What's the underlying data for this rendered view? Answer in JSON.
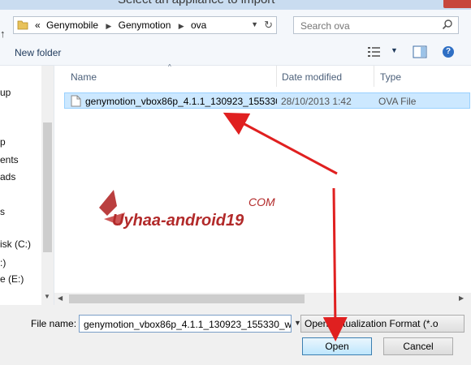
{
  "dialog": {
    "title": "Select an appliance to import"
  },
  "address": {
    "breadcrumbs": [
      "Genymobile",
      "Genymotion",
      "ova"
    ],
    "overflow": "«"
  },
  "search": {
    "placeholder": "Search ova"
  },
  "toolbar": {
    "new_folder": "New folder",
    "help": "?"
  },
  "navpane": {
    "items": [
      "up",
      "p",
      "ents",
      "ads",
      "s",
      "isk (C:)",
      ":)",
      "e (E:)"
    ]
  },
  "columns": {
    "name": "Name",
    "date": "Date modified",
    "type": "Type"
  },
  "files": [
    {
      "name": "genymotion_vbox86p_4.1.1_130923_155330_w",
      "date": "28/10/2013 1:42",
      "type": "OVA File"
    }
  ],
  "footer": {
    "file_name_label": "File name:",
    "file_name_value": "genymotion_vbox86p_4.1.1_130923_155330_w",
    "file_type_value": "Open Virtualization Format (*.o",
    "open_label": "Open",
    "cancel_label": "Cancel"
  },
  "watermark": {
    "text": "Uyhaa-android19",
    "suffix": "COM"
  },
  "colors": {
    "annotation_arrow": "#e02020",
    "selection": "#cce8ff"
  }
}
